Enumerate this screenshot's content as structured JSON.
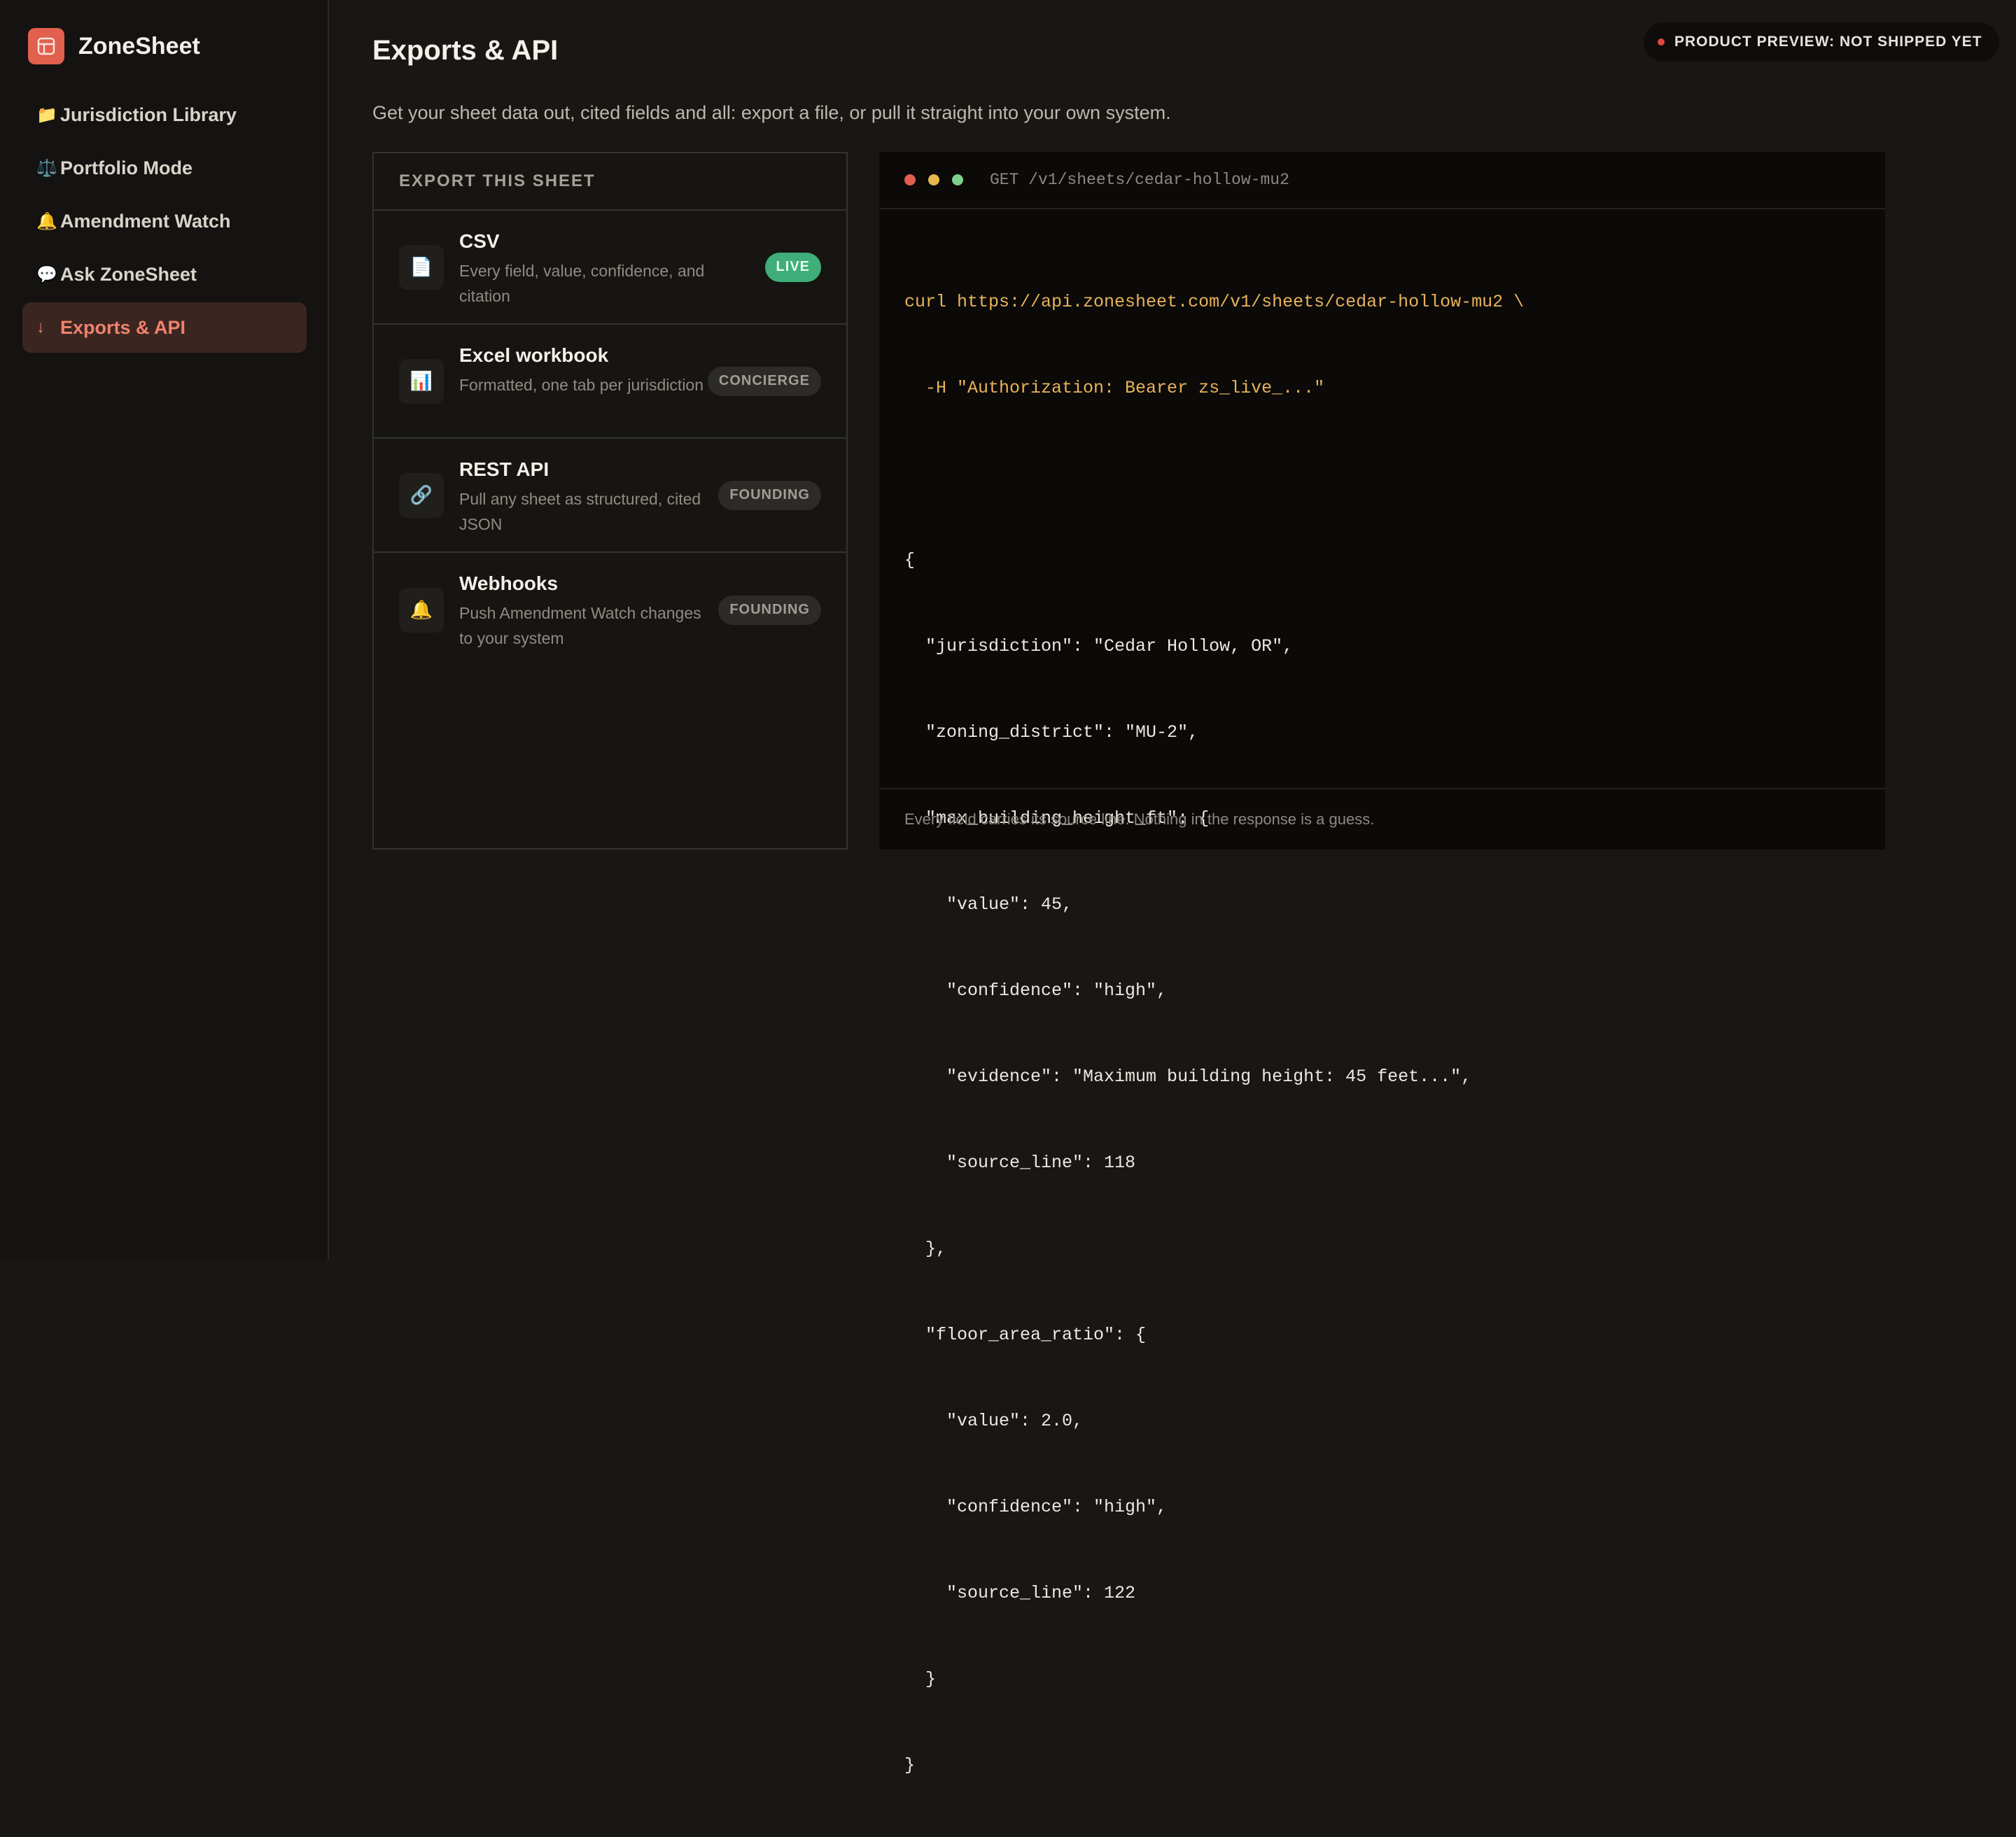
{
  "app": {
    "name": "ZoneSheet"
  },
  "sidebar": {
    "items": [
      {
        "icon": "📁",
        "icon_name": "folder-icon",
        "label": "Jurisdiction Library"
      },
      {
        "icon": "⚖️",
        "icon_name": "scales-icon",
        "label": "Portfolio Mode"
      },
      {
        "icon": "🔔",
        "icon_name": "bell-icon",
        "label": "Amendment Watch"
      },
      {
        "icon": "💬",
        "icon_name": "speech-bubble-icon",
        "label": "Ask ZoneSheet"
      },
      {
        "icon": "↓",
        "icon_name": "download-arrow-icon",
        "label": "Exports & API",
        "active": true
      }
    ]
  },
  "header": {
    "title": "Exports & API",
    "subtitle": "Get your sheet data out, cited fields and all: export a file, or pull it straight into your own system.",
    "preview_badge": "PRODUCT PREVIEW: NOT SHIPPED YET"
  },
  "export_panel": {
    "heading": "EXPORT THIS SHEET",
    "rows": [
      {
        "icon": "📄",
        "icon_name": "document-icon",
        "title": "CSV",
        "desc": "Every field, value, confidence, and citation",
        "badge": "LIVE"
      },
      {
        "icon": "📊",
        "icon_name": "bar-chart-icon",
        "title": "Excel workbook",
        "desc": "Formatted, one tab per jurisdiction",
        "badge": "CONCIERGE"
      },
      {
        "icon": "🔗",
        "icon_name": "link-icon",
        "title": "REST API",
        "desc": "Pull any sheet as structured, cited JSON",
        "badge": "FOUNDING"
      },
      {
        "icon": "🔔",
        "icon_name": "bell-icon",
        "title": "Webhooks",
        "desc": "Push Amendment Watch changes to your system",
        "badge": "FOUNDING"
      }
    ]
  },
  "code_panel": {
    "path": "GET /v1/sheets/cedar-hollow-mu2",
    "lines": [
      "curl https://api.zonesheet.com/v1/sheets/cedar-hollow-mu2 \\",
      "  -H \"Authorization: Bearer zs_live_...\"",
      "",
      "{",
      "  \"jurisdiction\": \"Cedar Hollow, OR\",",
      "  \"zoning_district\": \"MU-2\",",
      "  \"max_building_height_ft\": {",
      "    \"value\": 45,",
      "    \"confidence\": \"high\",",
      "    \"evidence\": \"Maximum building height: 45 feet...\",",
      "    \"source_line\": 118",
      "  },",
      "  \"floor_area_ratio\": {",
      "    \"value\": 2.0,",
      "    \"confidence\": \"high\",",
      "    \"source_line\": 122",
      "  }",
      "}"
    ],
    "footer": "Every field carries its source line. Nothing in the response is a guess."
  },
  "colors": {
    "accent": "#e2604e",
    "live_badge": "#3fae78",
    "code_command": "#e8b25a"
  }
}
